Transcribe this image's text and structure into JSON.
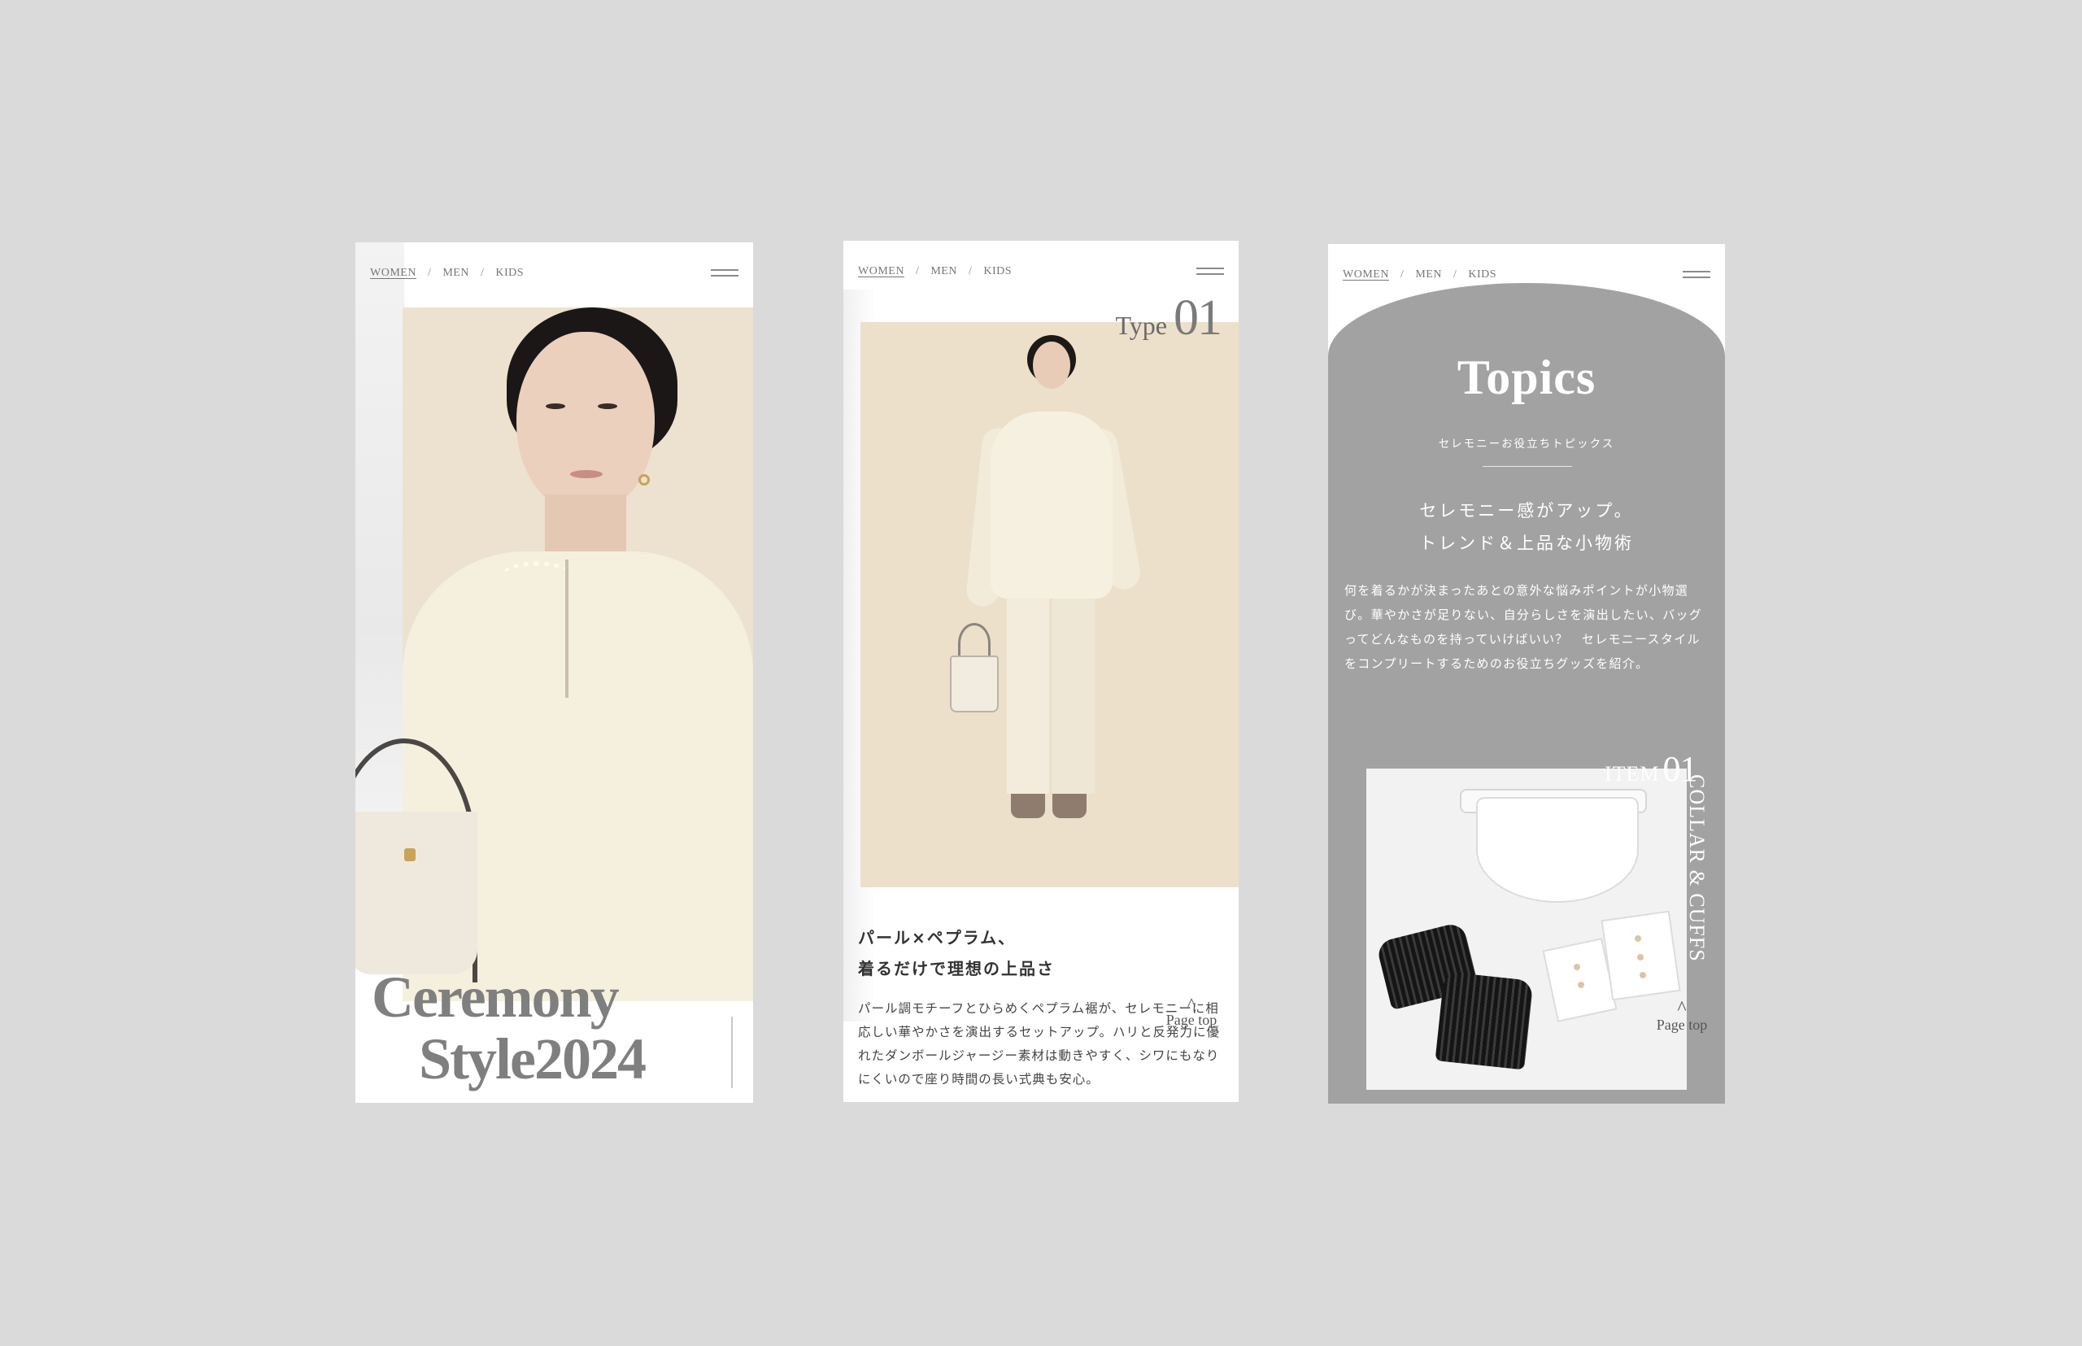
{
  "nav": {
    "women": "WOMEN",
    "men": "MEN",
    "kids": "KIDS",
    "separator": "/"
  },
  "screen1": {
    "title_line1": "Ceremony",
    "title_line2": "Style2024"
  },
  "screen2": {
    "type_word": "Type",
    "type_number": "01",
    "heading_line1": "パール×ペプラム、",
    "heading_line2": "着るだけで理想の上品さ",
    "body": "パール調モチーフとひらめくペプラム裾が、セレモニーに相応しい華やかさを演出するセットアップ。ハリと反発力に優れたダンボールジャージー素材は動きやすく、シワにもなりにくいので座り時間の長い式典も安心。",
    "page_top": "Page top",
    "page_top_caret": "^"
  },
  "screen3": {
    "title": "Topics",
    "subtitle": "セレモニーお役立ちトピックス",
    "lead_line1": "セレモニー感がアップ。",
    "lead_line2": "トレンド＆上品な小物術",
    "body": "何を着るかが決まったあとの意外な悩みポイントが小物選び。華やかさが足りない、自分らしさを演出したい、バッグってどんなものを持っていけばいい？　セレモニースタイルをコンプリートするためのお役立ちグッズを紹介。",
    "item_word": "ITEM",
    "item_number": "01",
    "item_name": "COLLAR & CUFFS",
    "page_top": "Page top",
    "page_top_caret": "^"
  },
  "colors": {
    "background": "#dadada",
    "topics_panel": "#a2a2a2",
    "title_gray": "#7f7f7f"
  },
  "icons": [
    "hamburger-menu-icon",
    "caret-up-icon"
  ]
}
